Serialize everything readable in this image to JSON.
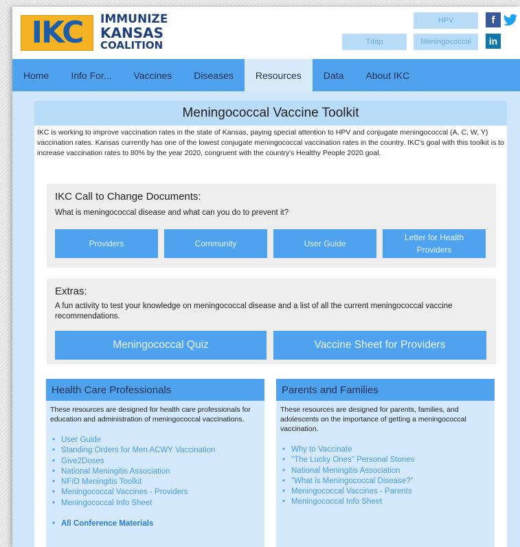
{
  "logo": {
    "letters": "IKC",
    "line1": "IMMUNIZE",
    "line2": "KANSAS",
    "line3": "COALITION"
  },
  "header_tabs": [
    "HPV",
    "Tdap",
    "Meningococcal"
  ],
  "social": {
    "facebook": "f",
    "twitter": "t",
    "linkedin": "in"
  },
  "nav": [
    "Home",
    "Info For...",
    "Vaccines",
    "Diseases",
    "Resources",
    "Data",
    "About IKC"
  ],
  "page_title": "Meningococcal Vaccine Toolkit",
  "intro": "IKC is working to improve vaccination rates in the state of Kansas, paying special attention to HPV and conjugate meningococcal (A, C, W, Y) vaccination rates. Kansas currently has one of the lowest conjugate meningococcal vaccination rates in the country. IKC's goal with this toolkit is to increase vaccination rates to 80% by the year 2020, congruent with the country's Healthy People 2020 goal.",
  "call_to_change": {
    "heading": "IKC Call to Change Documents:",
    "subtext": "What is meningococcal disease and what can you do to prevent it?",
    "buttons": [
      "Providers",
      "Community",
      "User Guide",
      "Letter for Health Providers"
    ]
  },
  "extras": {
    "heading": "Extras:",
    "subtext": "A fun activity to test your knowledge on meningococcal disease and a list of all the current meningococcal vaccine recommendations.",
    "buttons": [
      "Meningococcal Quiz",
      "Vaccine Sheet for Providers"
    ]
  },
  "hcp": {
    "heading": "Health Care Professionals",
    "desc": "These resources are designed for health care professionals for education and administration of meningococcal vaccinations.",
    "links": [
      "User Guide",
      "Standing Orders for Men ACWY Vaccination",
      "Give2Doses",
      "National Meningitis Association",
      "NFID Meningitis Toolkit",
      "Meningococcal Vaccines - Providers",
      "Meningococcal Info Sheet"
    ],
    "extra_link": "All Conference Materials"
  },
  "parents": {
    "heading": "Parents and Families",
    "desc": "These resources are designed for parents, families, and adolescents on the importance of getting a meningococcal vaccination.",
    "links": [
      "Why to Vaccinate",
      "\"The Lucky Ones\" Personal Stories",
      "National Meningitis Association",
      "\"What is Meningococcal Disease?\"",
      "Meningococcal Vaccines - Parents",
      "Meningococcal Info Sheet"
    ]
  },
  "colors": {
    "nav": "#4fa3ee",
    "title_bar": "#b9dcf8",
    "logo_bg": "#f5b324",
    "logo_text": "#1e5ea8",
    "link": "#4a9be6"
  }
}
